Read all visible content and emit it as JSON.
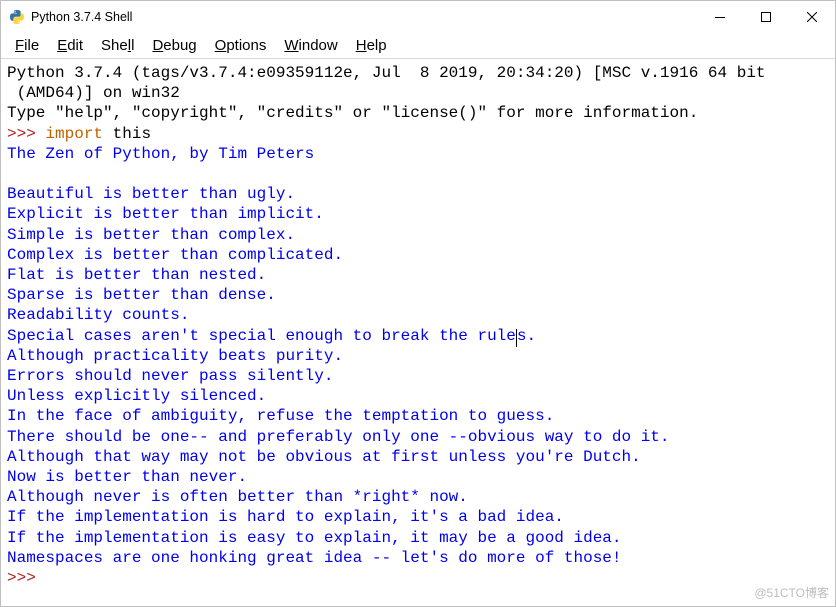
{
  "window": {
    "title": "Python 3.7.4 Shell"
  },
  "menus": {
    "file": {
      "letter": "F",
      "rest": "ile"
    },
    "edit": {
      "letter": "E",
      "rest": "dit"
    },
    "shell": {
      "pre": "She",
      "letter": "l",
      "rest": "l"
    },
    "debug": {
      "letter": "D",
      "rest": "ebug"
    },
    "options": {
      "letter": "O",
      "rest": "ptions"
    },
    "windowm": {
      "letter": "W",
      "rest": "indow"
    },
    "help": {
      "letter": "H",
      "rest": "elp"
    }
  },
  "shell": {
    "banner1": "Python 3.7.4 (tags/v3.7.4:e09359112e, Jul  8 2019, 20:34:20) [MSC v.1916 64 bit",
    "banner2": " (AMD64)] on win32",
    "banner3": "Type \"help\", \"copyright\", \"credits\" or \"license()\" for more information.",
    "prompt": ">>>",
    "sp": " ",
    "kw_import": "import",
    "mod": " this",
    "z01": "The Zen of Python, by Tim Peters",
    "z_blank": "",
    "z02": "Beautiful is better than ugly.",
    "z03": "Explicit is better than implicit.",
    "z04": "Simple is better than complex.",
    "z05": "Complex is better than complicated.",
    "z06": "Flat is better than nested.",
    "z07": "Sparse is better than dense.",
    "z08": "Readability counts.",
    "z09a": "Special cases aren't special enough to break the rule",
    "z09b": "s.",
    "z10": "Although practicality beats purity.",
    "z11": "Errors should never pass silently.",
    "z12": "Unless explicitly silenced.",
    "z13": "In the face of ambiguity, refuse the temptation to guess.",
    "z14": "There should be one-- and preferably only one --obvious way to do it.",
    "z15": "Although that way may not be obvious at first unless you're Dutch.",
    "z16": "Now is better than never.",
    "z17": "Although never is often better than *right* now.",
    "z18": "If the implementation is hard to explain, it's a bad idea.",
    "z19": "If the implementation is easy to explain, it may be a good idea.",
    "z20": "Namespaces are one honking great idea -- let's do more of those!"
  },
  "watermark": "@51CTO博客"
}
